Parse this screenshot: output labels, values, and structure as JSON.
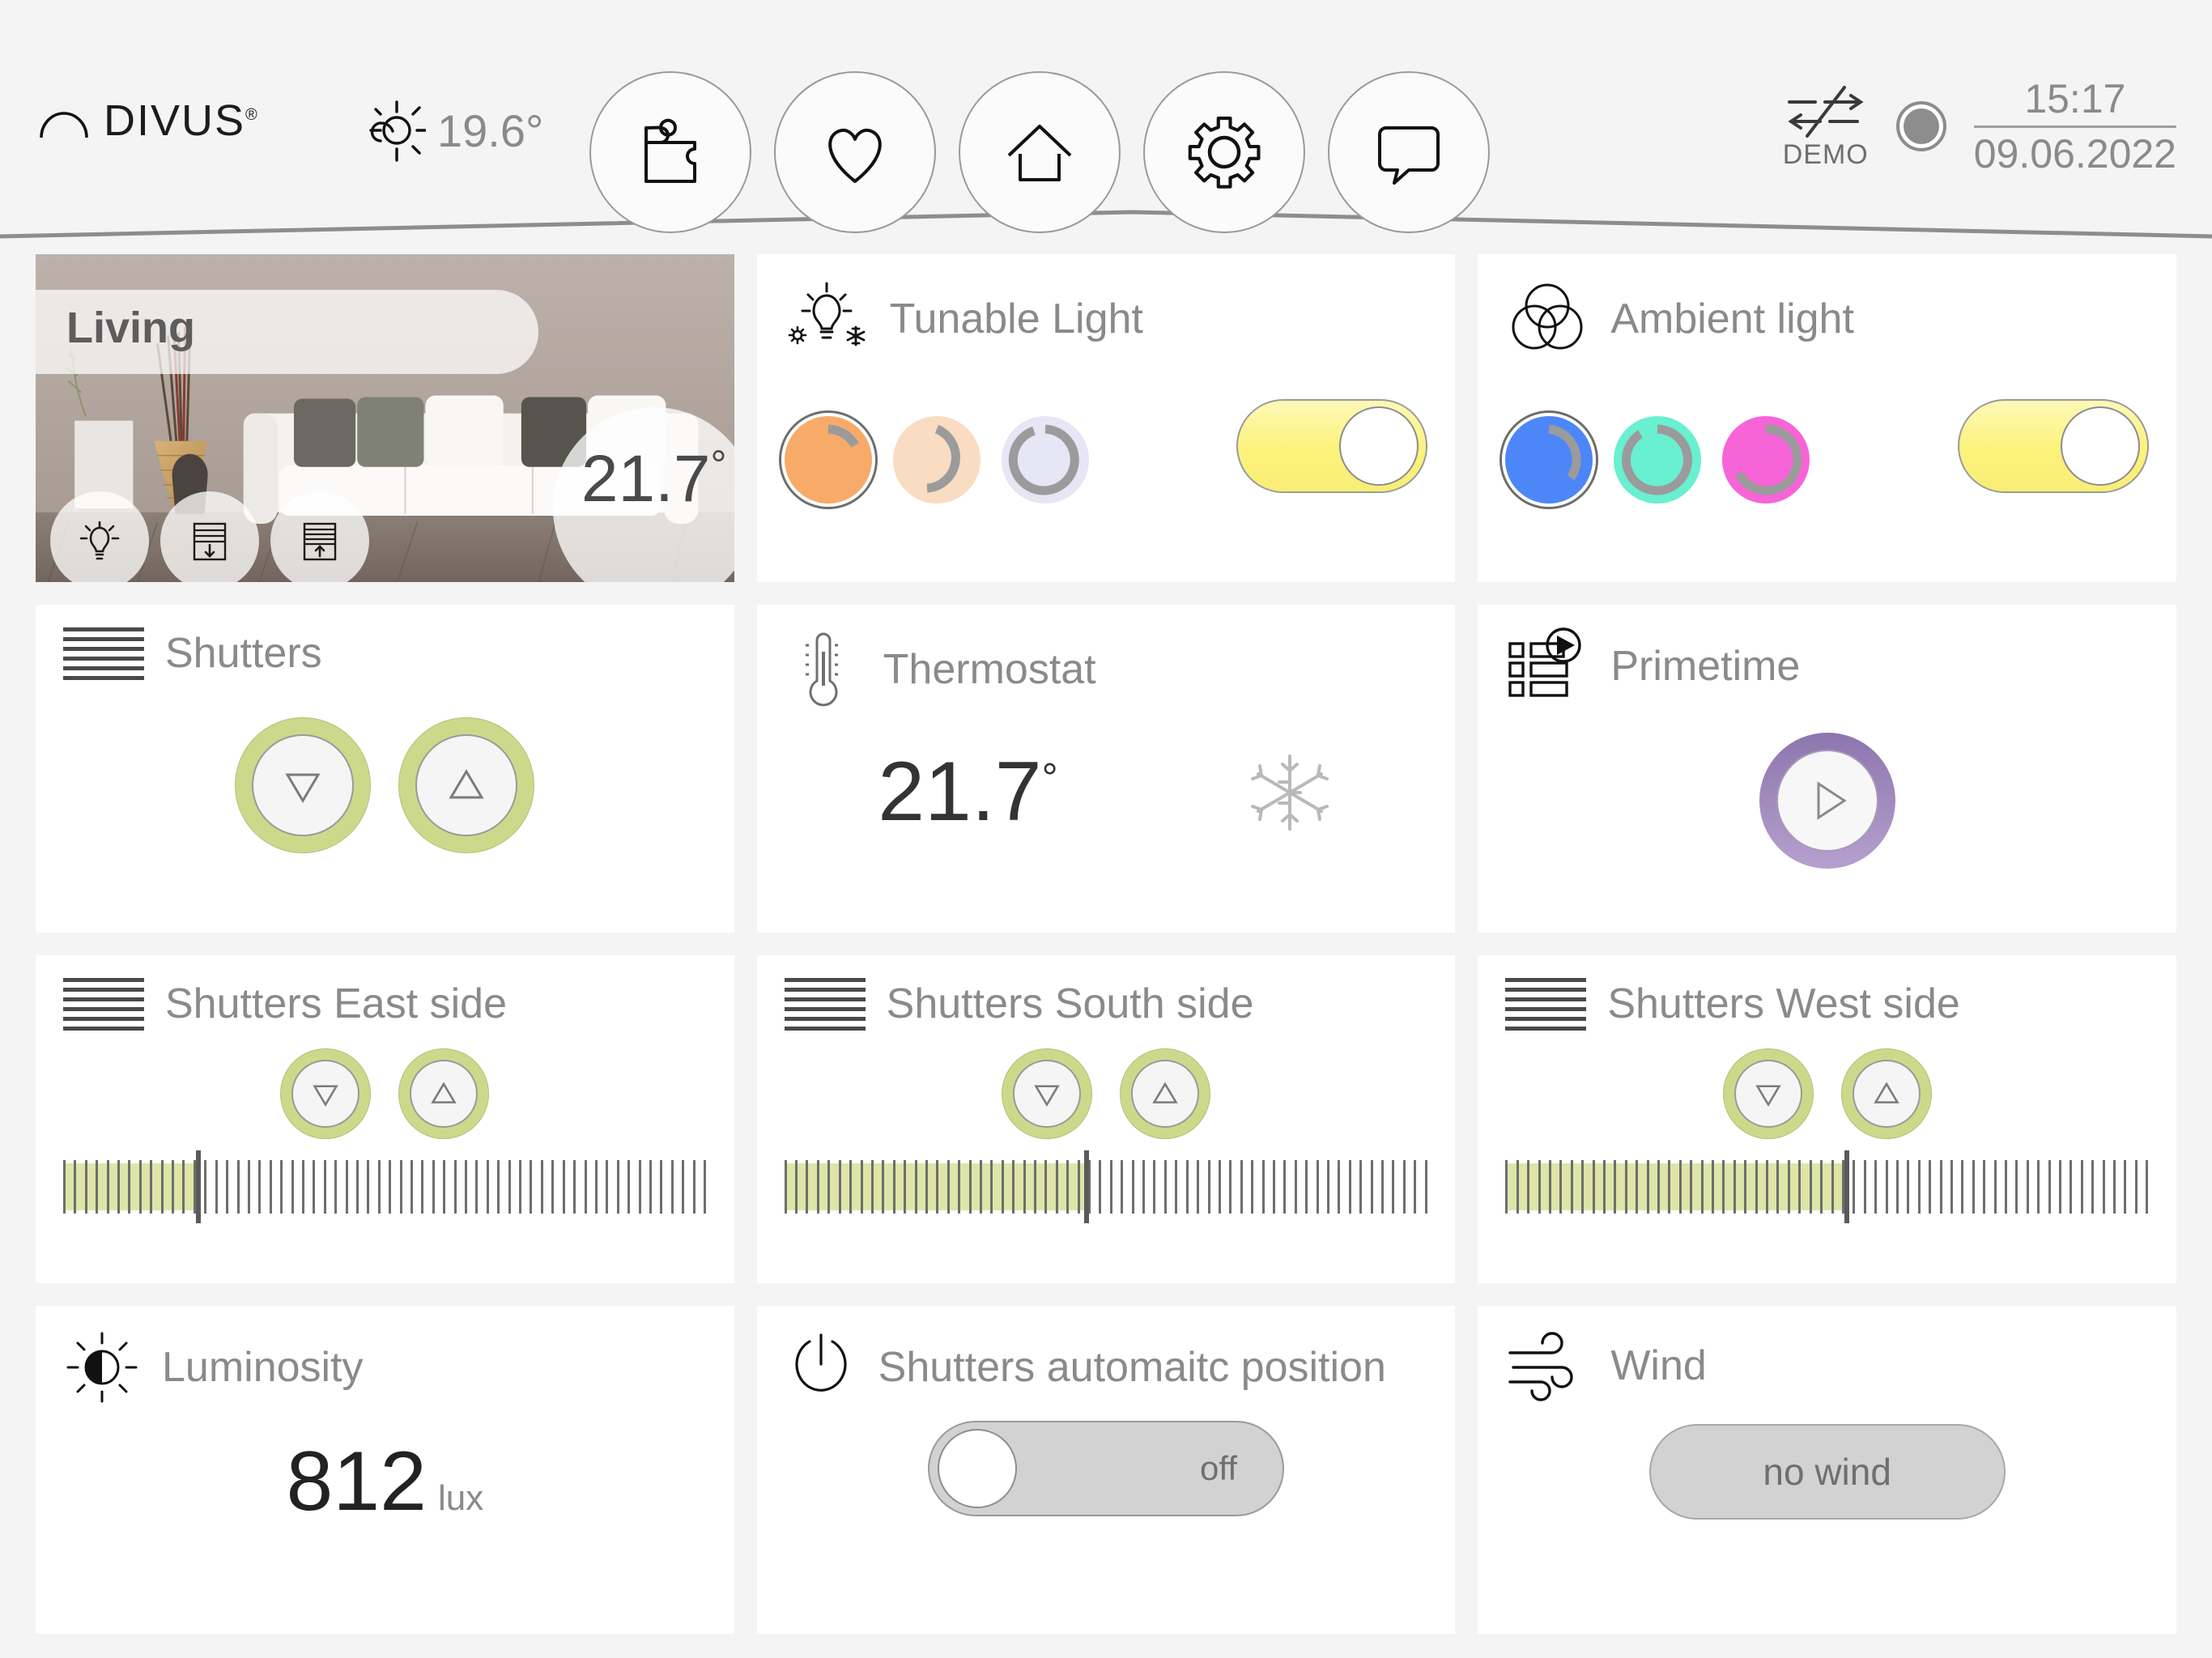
{
  "header": {
    "brand": "DIVUS",
    "brand_reg": "®",
    "weather_temp": "19.6°",
    "weather_icon": "sun-cloud-icon",
    "nav": [
      {
        "name": "puzzle",
        "icon": "puzzle-icon",
        "label": "Plugins"
      },
      {
        "name": "favorites",
        "icon": "heart-icon",
        "label": "Favorites"
      },
      {
        "name": "home",
        "icon": "house-icon",
        "label": "Home"
      },
      {
        "name": "settings",
        "icon": "gear-icon",
        "label": "Settings"
      },
      {
        "name": "messages",
        "icon": "speech-bubble-icon",
        "label": "Messages"
      }
    ],
    "demo_label": "DEMO",
    "demo_icon": "sync-disabled-icon",
    "status_dot": "connection-status-indicator",
    "time": "15:17",
    "date": "09.06.2022"
  },
  "cards": {
    "living": {
      "title": "Living",
      "temperature": "21.7",
      "degree": "°",
      "buttons": [
        {
          "name": "light",
          "icon": "lightbulb-icon"
        },
        {
          "name": "shutter-down",
          "icon": "shutter-down-icon"
        },
        {
          "name": "shutter-up",
          "icon": "shutter-up-icon"
        }
      ]
    },
    "tunable_light": {
      "title": "Tunable Light",
      "icon": "tunable-bulb-icon",
      "swatches": [
        {
          "color": "#f8ab68",
          "arc": 22,
          "selected": true
        },
        {
          "color": "#f9dcc2",
          "arc": 48,
          "selected": false
        },
        {
          "color": "#e4e4f3",
          "arc": 78,
          "selected": false
        }
      ],
      "toggle_state": "on"
    },
    "ambient_light": {
      "title": "Ambient light",
      "icon": "rgb-circles-icon",
      "swatches": [
        {
          "color": "#4d86f7",
          "arc": 30,
          "selected": true
        },
        {
          "color": "#69f0d0",
          "arc": 72,
          "selected": false
        },
        {
          "color": "#f764d8",
          "arc": 62,
          "selected": false
        }
      ],
      "toggle_state": "on"
    },
    "shutters": {
      "title": "Shutters",
      "icon": "shutter-lines-icon",
      "down_label": "down",
      "up_label": "up"
    },
    "thermostat": {
      "title": "Thermostat",
      "icon": "thermometer-icon",
      "value": "21.7",
      "degree": "°",
      "mode_icon": "snowflake-icon"
    },
    "primetime": {
      "title": "Primetime",
      "icon": "scene-list-icon",
      "play_icon": "play-icon"
    },
    "shutters_east": {
      "title": "Shutters East side",
      "icon": "shutter-lines-icon",
      "position": 21
    },
    "shutters_south": {
      "title": "Shutters South side",
      "icon": "shutter-lines-icon",
      "position": 47
    },
    "shutters_west": {
      "title": "Shutters West side",
      "icon": "shutter-lines-icon",
      "position": 53
    },
    "luminosity": {
      "title": "Luminosity",
      "icon": "brightness-half-icon",
      "value": "812",
      "unit": "lux"
    },
    "shutters_auto": {
      "title": "Shutters automaitc position",
      "icon": "power-icon",
      "toggle_state": "off",
      "toggle_label": "off"
    },
    "wind": {
      "title": "Wind",
      "icon": "wind-icon",
      "status": "no wind"
    }
  },
  "colors": {
    "accent_green": "#cdd98a",
    "toggle_on": "#fdf27a",
    "toggle_off": "#d2d2d2",
    "purple": "#a78fc4",
    "text_gray": "#8a8a8a"
  }
}
